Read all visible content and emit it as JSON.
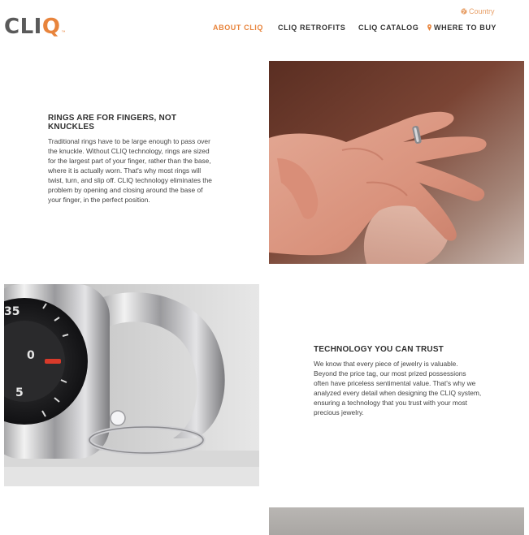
{
  "header": {
    "logo": {
      "text_main": "CLI",
      "text_accent": "Q",
      "trademark": "™"
    },
    "country_label": "Country",
    "nav": [
      {
        "label": "ABOUT CLIQ",
        "active": true
      },
      {
        "label": "CLIQ RETROFITS",
        "active": false
      },
      {
        "label": "CLIQ CATALOG",
        "active": false
      },
      {
        "label": "WHERE TO BUY",
        "active": false,
        "icon": "map-pin-icon"
      }
    ]
  },
  "sections": [
    {
      "heading": "RINGS ARE FOR FINGERS, NOT KNUCKLES",
      "body": "Traditional rings have to be large enough to pass over the knuckle. Without CLIQ technology, rings are sized for the largest part of your finger, rather than the base, where it is actually worn. That's why most rings will twist, turn, and slip off. CLIQ technology eliminates the problem by opening and closing around the base of your finger, in the perfect position.",
      "image": "hand-with-ring-photo"
    },
    {
      "heading": "TECHNOLOGY YOU CAN TRUST",
      "body": "We know that every piece of jewelry is valuable. Beyond the price tag, our most prized possessions often have priceless sentimental value. That's why we analyzed every detail when designing the CLIQ system, ensuring a technology that you trust with your most precious jewelry.",
      "image": "padlock-with-ring-photo"
    }
  ],
  "colors": {
    "accent": "#e8843c",
    "logo_gray": "#5a5a5a",
    "text_dark": "#333333"
  }
}
